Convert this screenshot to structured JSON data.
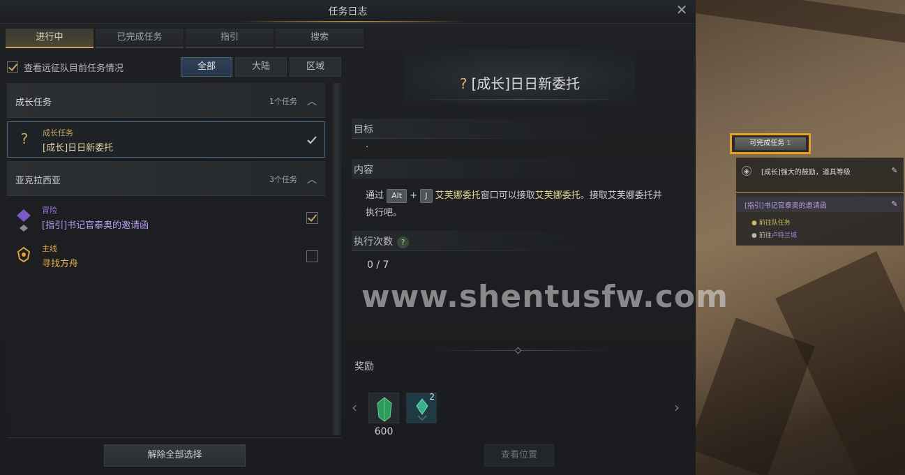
{
  "window": {
    "title": "任务日志"
  },
  "tabs": [
    {
      "label": "进行中",
      "active": true
    },
    {
      "label": "已完成任务",
      "active": false
    },
    {
      "label": "指引",
      "active": false
    },
    {
      "label": "搜索",
      "active": false
    }
  ],
  "filter": {
    "expedition_check_label": "查看远征队目前任务情况",
    "expedition_checked": true,
    "scope_buttons": [
      "全部",
      "大陆",
      "区域"
    ],
    "active_scope": "全部"
  },
  "categories": [
    {
      "name": "成长任务",
      "count": "1个任务",
      "quests": [
        {
          "type": "成长任务",
          "name": "[成长]日日新委托",
          "icon": "question-mark-icon",
          "checked": true,
          "selected": true
        }
      ]
    },
    {
      "name": "亚克拉西亚",
      "count": "3个任务",
      "quests": [
        {
          "type": "冒险",
          "name": "[指引]书记官泰奥的邀请函",
          "icon": "adventure-icon",
          "checked": true,
          "selected": false
        },
        {
          "type": "主线",
          "name": "寻找方舟",
          "icon": "main-quest-icon",
          "checked": false,
          "selected": false
        }
      ]
    }
  ],
  "deselect_all_label": "解除全部选择",
  "detail": {
    "title": "[成长]日日新委托",
    "objective_label": "目标",
    "objective_text": "·",
    "content_label": "内容",
    "content": {
      "prefix": "通过",
      "key1": "Alt",
      "plus": "+",
      "key2": "J",
      "text1": "艾芙娜委托",
      "text2": "窗口可以接取",
      "text3": "艾芙娜委托",
      "text4": "。接取艾芙娜委托并执行吧。"
    },
    "exec_count_label": "执行次数",
    "exec_count_value": "0 / 7",
    "reward_label": "奖励",
    "rewards": [
      {
        "icon": "green-crystal-icon",
        "amount": "600",
        "count": ""
      },
      {
        "icon": "crystal-shard-icon",
        "amount": "",
        "count": "2"
      }
    ],
    "view_location_label": "查看位置"
  },
  "watermark": "www.shentusfw.com",
  "tracker": {
    "completable_label": "可完成任务",
    "completable_count": "1",
    "quest1": "[成长]强大的鼓励，道具等级",
    "quest2": "[指引]书记官泰奥的邀请函",
    "sub1": "前往队任务",
    "sub2_prefix": "前往",
    "sub2_place": "卢特兰城"
  },
  "colors": {
    "accent_gold": "#c9a960",
    "highlight_yellow": "#e2d58c",
    "adventure_purple": "#9a7ae0",
    "main_quest_orange": "#e0a040",
    "tracker_border": "#e8a020"
  }
}
